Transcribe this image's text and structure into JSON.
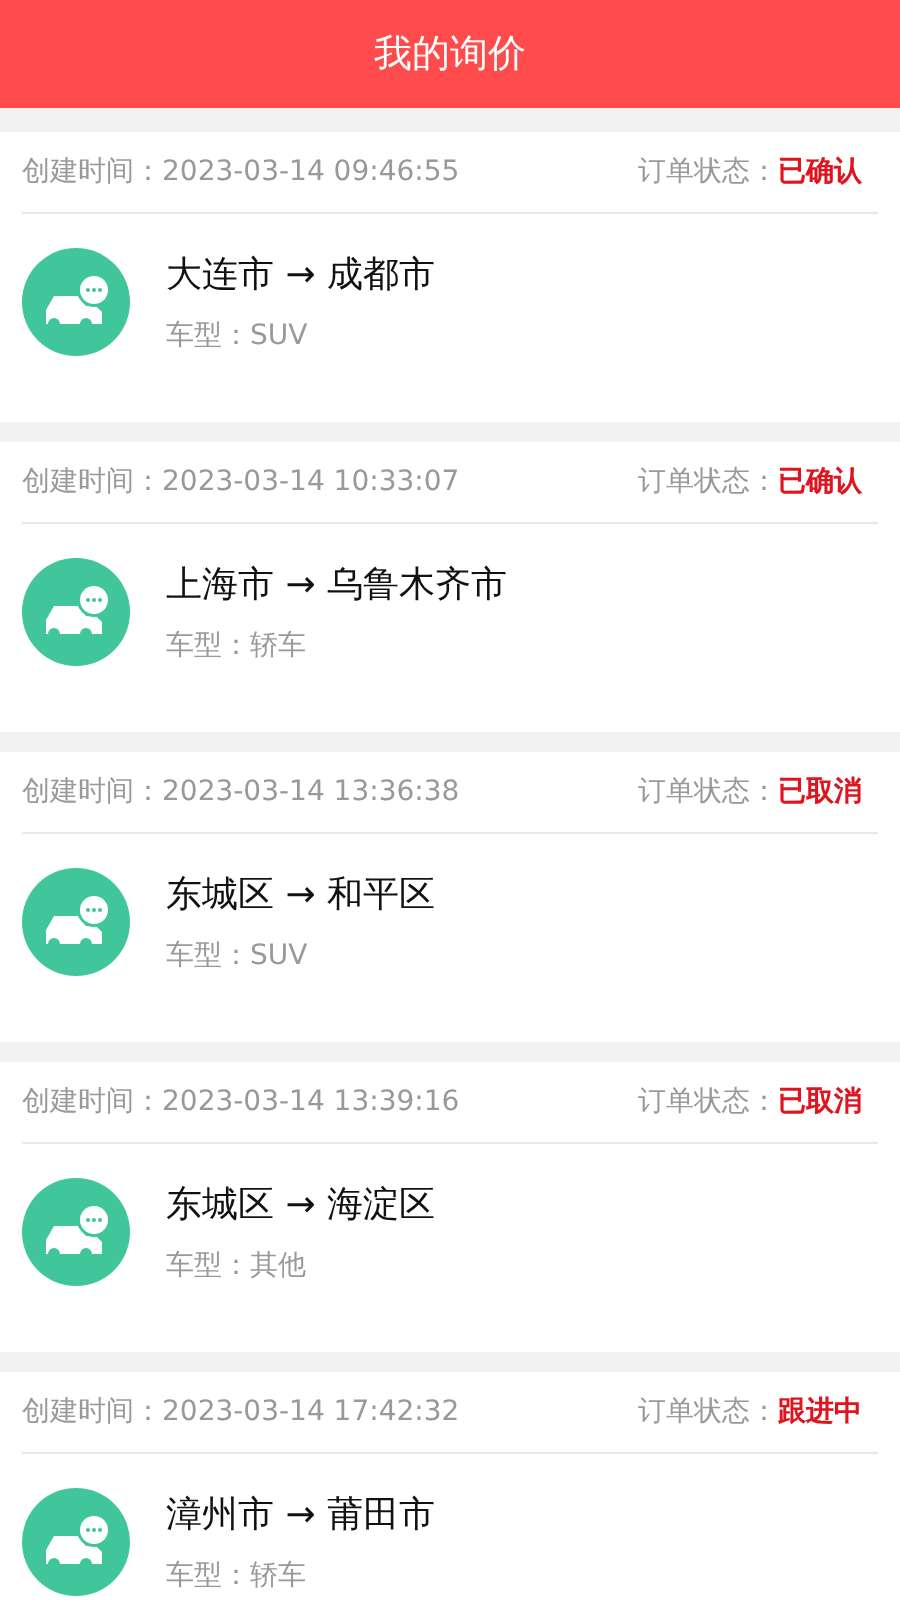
{
  "header": {
    "title": "我的询价"
  },
  "orders": [
    {
      "created": "创建时间：2023-03-14 09:46:55",
      "status_label": "订单状态：",
      "status": "已确认",
      "route": "大连市 → 成都市",
      "car_type": "车型：SUV"
    },
    {
      "created": "创建时间：2023-03-14 10:33:07",
      "status_label": "订单状态：",
      "status": "已确认",
      "route": "上海市 → 乌鲁木齐市",
      "car_type": "车型：轿车"
    },
    {
      "created": "创建时间：2023-03-14 13:36:38",
      "status_label": "订单状态：",
      "status": "已取消",
      "route": "东城区 → 和平区",
      "car_type": "车型：SUV"
    },
    {
      "created": "创建时间：2023-03-14 13:39:16",
      "status_label": "订单状态：",
      "status": "已取消",
      "route": "东城区 → 海淀区",
      "car_type": "车型：其他"
    },
    {
      "created": "创建时间：2023-03-14 17:42:32",
      "status_label": "订单状态：",
      "status": "跟进中",
      "route": "漳州市 → 莆田市",
      "car_type": "车型：轿车"
    }
  ]
}
